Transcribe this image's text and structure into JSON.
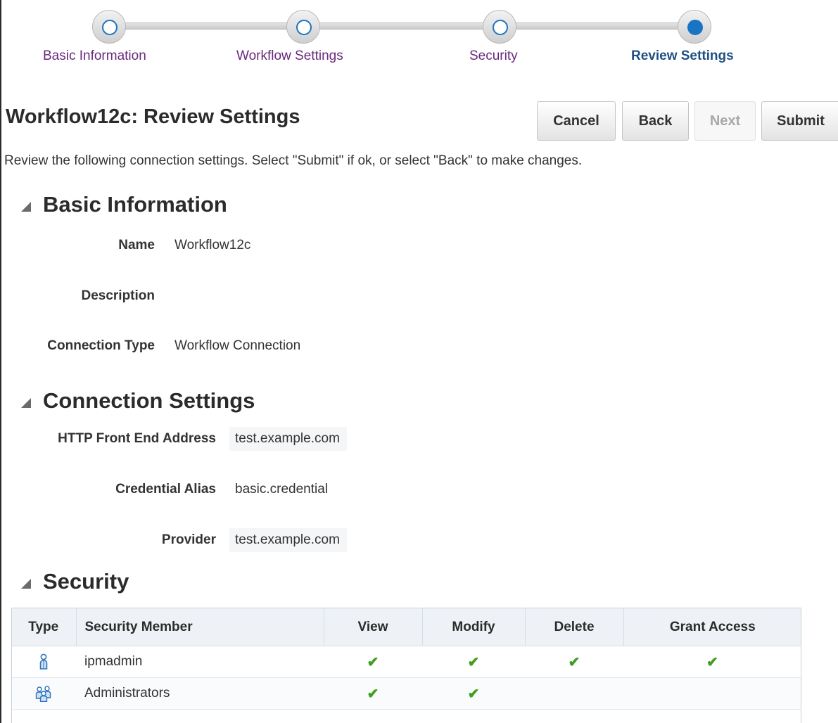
{
  "train": {
    "stops": [
      {
        "label": "Basic Information",
        "state": "visited"
      },
      {
        "label": "Workflow Settings",
        "state": "visited"
      },
      {
        "label": "Security",
        "state": "visited"
      },
      {
        "label": "Review Settings",
        "state": "current"
      }
    ]
  },
  "header": {
    "title": "Workflow12c: Review Settings",
    "buttons": {
      "cancel": "Cancel",
      "back": "Back",
      "next": "Next",
      "submit": "Submit"
    },
    "instructions": "Review the following connection settings. Select \"Submit\" if ok, or select \"Back\" to make changes."
  },
  "basic_info": {
    "heading": "Basic Information",
    "name_label": "Name",
    "name_value": "Workflow12c",
    "description_label": "Description",
    "description_value": "",
    "type_label": "Connection Type",
    "type_value": "Workflow Connection"
  },
  "connection_settings": {
    "heading": "Connection Settings",
    "http_label": "HTTP Front End Address",
    "http_value": "test.example.com",
    "alias_label": "Credential Alias",
    "alias_value": "basic.credential",
    "provider_label": "Provider",
    "provider_value": "test.example.com"
  },
  "security": {
    "heading": "Security",
    "columns": {
      "type": "Type",
      "member": "Security Member",
      "view": "View",
      "modify": "Modify",
      "delete": "Delete",
      "grant": "Grant Access"
    },
    "rows": [
      {
        "type_icon": "user-icon",
        "member": "ipmadmin",
        "view": true,
        "modify": true,
        "delete": true,
        "grant": true
      },
      {
        "type_icon": "group-icon",
        "member": "Administrators",
        "view": true,
        "modify": true,
        "delete": false,
        "grant": false
      }
    ],
    "check_glyph": "✔"
  },
  "colors": {
    "accent_blue": "#1a74c4",
    "link_purple": "#6a2a7c",
    "check_green": "#3f9e1f"
  }
}
